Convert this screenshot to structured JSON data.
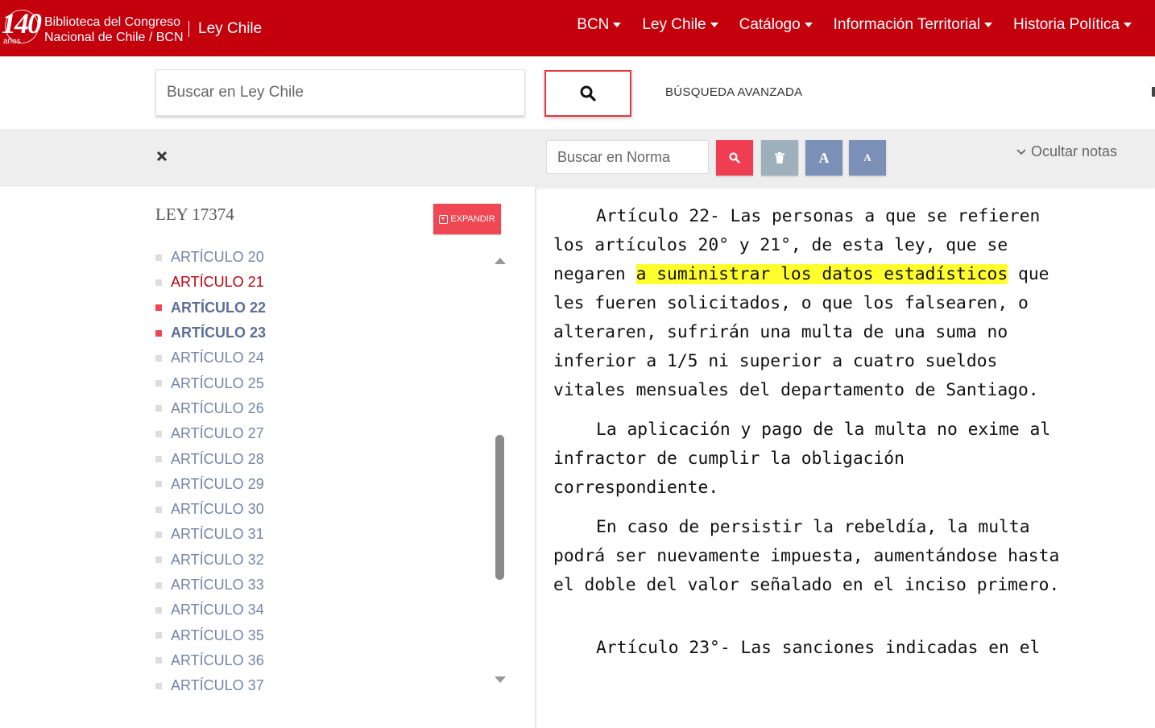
{
  "header": {
    "logo_number": "140",
    "logo_years": "años",
    "org_line1": "Biblioteca del Congreso",
    "org_line2": "Nacional de Chile / BCN",
    "app_name": "Ley Chile",
    "nav": [
      "BCN",
      "Ley Chile",
      "Catálogo",
      "Información Territorial",
      "Historia Política"
    ]
  },
  "search": {
    "placeholder": "Buscar en Ley Chile",
    "advanced_label": "BÚSQUEDA AVANZADA"
  },
  "toolbar": {
    "norm_search_placeholder": "Buscar en Norma",
    "font_large": "A",
    "font_small": "A",
    "hide_notes_label": "Ocultar notas"
  },
  "sidebar": {
    "law_title": "LEY 17374",
    "expand_label": "EXPANDIR",
    "articles": [
      {
        "label": "ARTÍCULO 20",
        "state": "normal"
      },
      {
        "label": "ARTÍCULO 21",
        "state": "active"
      },
      {
        "label": "ARTÍCULO 22",
        "state": "bold"
      },
      {
        "label": "ARTÍCULO 23",
        "state": "bold"
      },
      {
        "label": "ARTÍCULO 24",
        "state": "normal"
      },
      {
        "label": "ARTÍCULO 25",
        "state": "normal"
      },
      {
        "label": "ARTÍCULO 26",
        "state": "normal"
      },
      {
        "label": "ARTÍCULO 27",
        "state": "normal"
      },
      {
        "label": "ARTÍCULO 28",
        "state": "normal"
      },
      {
        "label": "ARTÍCULO 29",
        "state": "normal"
      },
      {
        "label": "ARTÍCULO 30",
        "state": "normal"
      },
      {
        "label": "ARTÍCULO 31",
        "state": "normal"
      },
      {
        "label": "ARTÍCULO 32",
        "state": "normal"
      },
      {
        "label": "ARTÍCULO 33",
        "state": "normal"
      },
      {
        "label": "ARTÍCULO 34",
        "state": "normal"
      },
      {
        "label": "ARTÍCULO 35",
        "state": "normal"
      },
      {
        "label": "ARTÍCULO 36",
        "state": "normal"
      },
      {
        "label": "ARTÍCULO 37",
        "state": "normal"
      }
    ]
  },
  "document": {
    "p1_before": "Artículo 22- Las personas a que se refieren los artículos 20° y 21°, de esta ley, que se negaren ",
    "p1_highlight": "a suministrar los datos estadísticos",
    "p1_after": " que les fueren solicitados, o que los falsearen, o alteraren, sufrirán una multa de una suma no inferior a 1/5 ni superior a cuatro sueldos vitales mensuales del departamento de Santiago.",
    "p2": "La aplicación y pago de la multa no exime al infractor de cumplir la obligación correspondiente.",
    "p3": "En caso de persistir la rebeldía, la multa podrá ser nuevamente impuesta, aumentándose hasta el doble del valor señalado en el inciso primero.",
    "p4": "Artículo 23°- Las sanciones indicadas en el"
  },
  "colors": {
    "brand_red": "#c4000c",
    "button_red": "#ef4754",
    "link_blue": "#7384aa",
    "highlight": "#ffff2e"
  }
}
